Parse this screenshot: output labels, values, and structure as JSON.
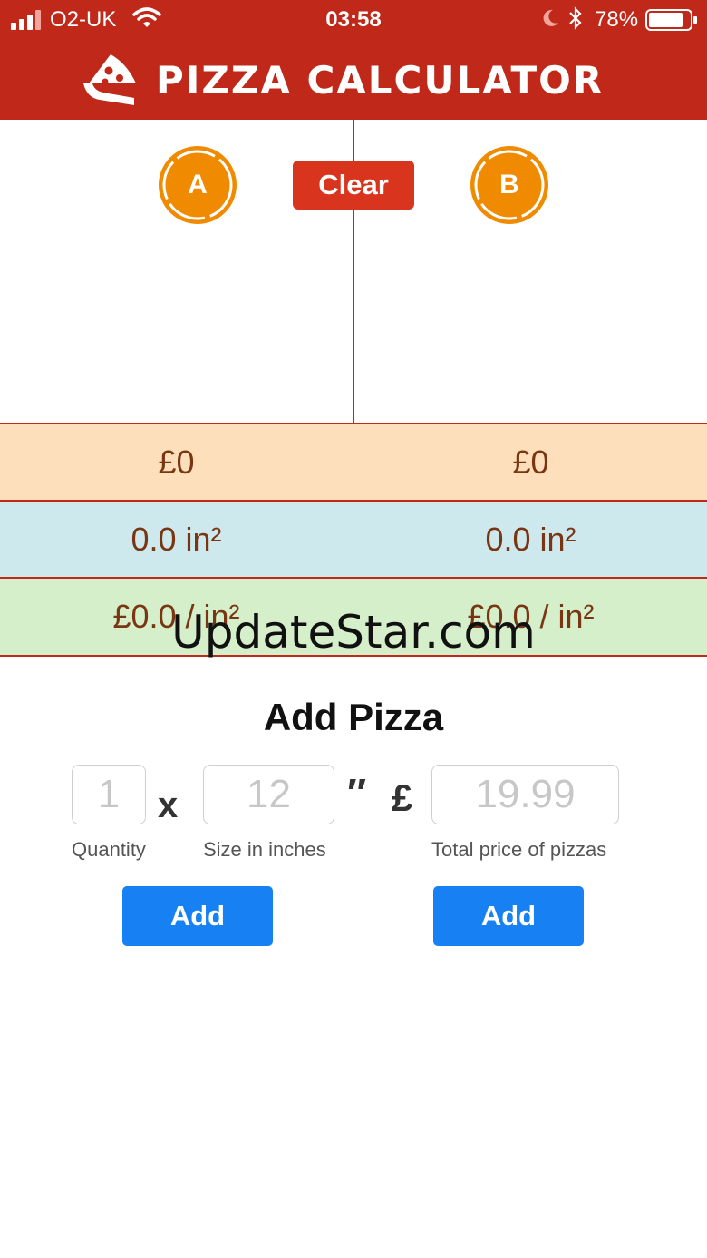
{
  "status_bar": {
    "carrier": "O2-UK",
    "time": "03:58",
    "battery": "78%",
    "icons": [
      "signal-icon",
      "wifi-icon",
      "moon-icon",
      "bluetooth-icon",
      "battery-icon"
    ]
  },
  "header": {
    "title": "PIZZA CALCULATOR",
    "icon": "pizza-slice-icon"
  },
  "comparison": {
    "pizza_a_label": "A",
    "pizza_b_label": "B",
    "clear_label": "Clear",
    "price_a": "£0",
    "price_b": "£0",
    "area_a": "0.0 in²",
    "area_b": "0.0 in²",
    "per_area_a": "£0.0 / in²",
    "per_area_b": "£0.0 / in²"
  },
  "watermark": "UpdateStar.com",
  "form": {
    "title": "Add Pizza",
    "quantity_placeholder": "1",
    "times": "x",
    "size_placeholder": "12",
    "inch_mark": "″",
    "currency": "£",
    "price_placeholder": "19.99",
    "quantity_caption": "Quantity",
    "size_caption": "Size in inches",
    "price_caption": "Total price of pizzas",
    "add_a_label": "Add",
    "add_b_label": "Add"
  },
  "colors": {
    "brand_red": "#c0291a",
    "badge_orange": "#f08a00",
    "clear_red": "#d8341e",
    "price_row": "#fde0bb",
    "area_row": "#cde9ee",
    "ppi_row": "#d5efcb",
    "button_blue": "#1780f2"
  }
}
